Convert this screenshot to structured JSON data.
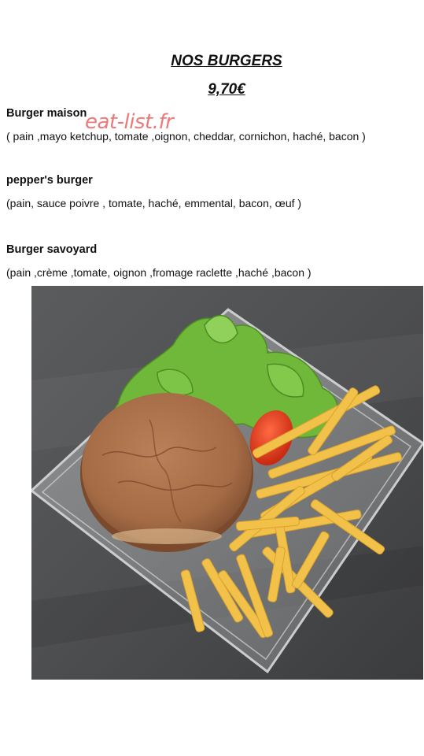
{
  "menu": {
    "heading": "NOS BURGERS",
    "price": "9,70€",
    "watermark": "eat-list.fr",
    "items": [
      {
        "name": "Burger maison",
        "description": "( pain ,mayo ketchup, tomate ,oignon, cheddar, cornichon, haché, bacon )"
      },
      {
        "name": "pepper's burger",
        "description": "(pain, sauce poivre , tomate, haché, emmental, bacon, œuf )"
      },
      {
        "name": "Burger savoyard",
        "description": "(pain ,crème ,tomate, oignon ,fromage raclette ,haché ,bacon )"
      }
    ]
  },
  "colors": {
    "watermark": "#e85a5a",
    "counter": "#4f5051",
    "bun": "#a8704a",
    "lettuce": "#6fb83a",
    "tomato": "#e23c1e",
    "fries": "#f2c14a"
  }
}
